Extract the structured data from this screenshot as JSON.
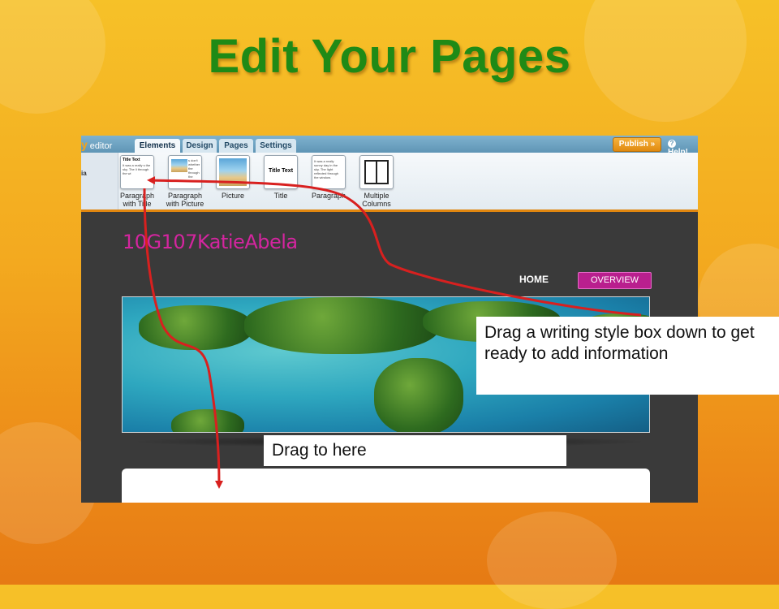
{
  "slide": {
    "title": "Edit Your Pages"
  },
  "editor": {
    "brand_letter": "y",
    "brand_label": "editor",
    "tabs": [
      {
        "label": "Elements",
        "active": true
      },
      {
        "label": "Design",
        "active": false
      },
      {
        "label": "Pages",
        "active": false
      },
      {
        "label": "Settings",
        "active": false
      }
    ],
    "publish_label": "Publish »",
    "help_label": "Help!",
    "left_panel_text": "ia",
    "tools": [
      {
        "label_line1": "Paragraph",
        "label_line2": "with Title",
        "thumb_title": "Title Text",
        "thumb_text": "It was a really s the sky. The li through the wi"
      },
      {
        "label_line1": "Paragraph",
        "label_line2": "with Picture",
        "thumb_text": "s don't whether the through the"
      },
      {
        "label_line1": "Picture",
        "label_line2": ""
      },
      {
        "label_line1": "Title",
        "label_line2": "",
        "thumb_title": "Title Text"
      },
      {
        "label_line1": "Paragraph",
        "label_line2": "",
        "thumb_text": "It was a really sunny day in the sky. The light reflected through the window."
      },
      {
        "label_line1": "Multiple",
        "label_line2": "Columns"
      }
    ],
    "site_title": "10G107KatieAbela",
    "nav": {
      "home": "HOME",
      "overview": "OVERVIEW"
    }
  },
  "callouts": {
    "drag_style": "Drag a writing style box down to get ready to add information",
    "drag_here": "Drag to here"
  },
  "colors": {
    "title_green": "#1f8a16",
    "site_title_pink": "#d4259f",
    "overview_button": "#b91f8e",
    "arrow_red": "#d8201f",
    "publish_orange": "#f0a02a"
  }
}
